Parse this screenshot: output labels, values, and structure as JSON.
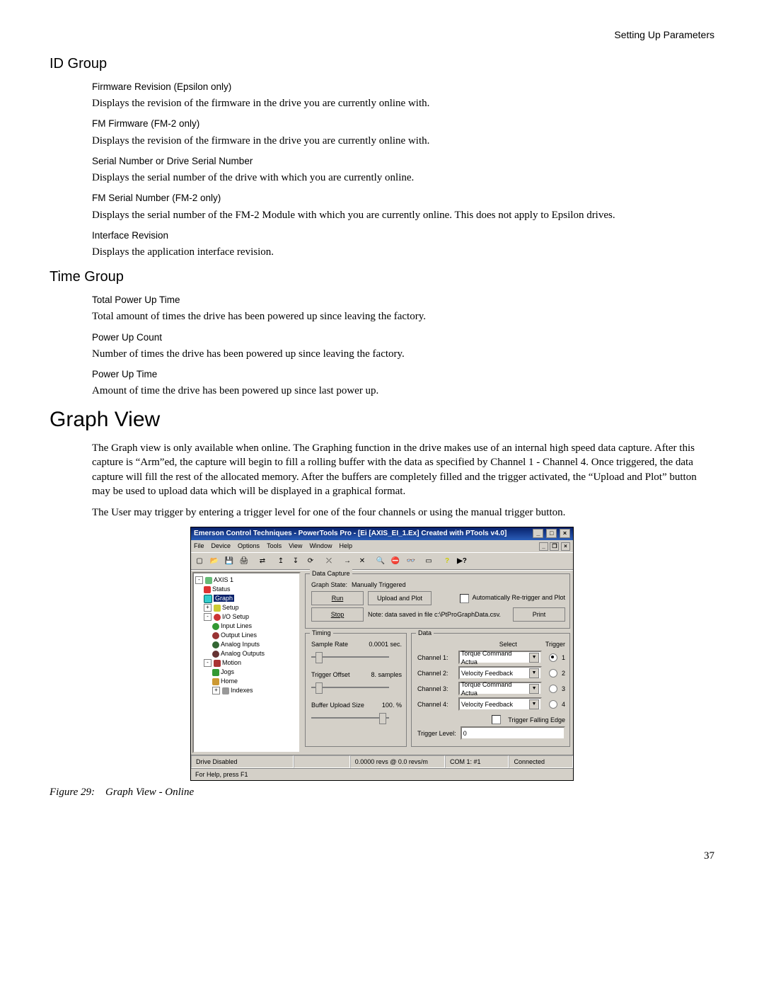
{
  "page": {
    "header_right": "Setting Up Parameters",
    "number": "37"
  },
  "sections": {
    "id_group": {
      "title": "ID Group",
      "items": [
        {
          "label": "Firmware Revision (Epsilon only)",
          "body": "Displays the revision of the firmware in the drive you are currently online with."
        },
        {
          "label": "FM Firmware (FM-2 only)",
          "body": "Displays the revision of the firmware in the drive you are currently online with."
        },
        {
          "label": "Serial Number or Drive Serial Number",
          "body": "Displays the serial number of the drive with which you are currently online."
        },
        {
          "label": "FM Serial Number (FM-2 only)",
          "body": "Displays the serial number of the FM-2 Module with which you are currently online. This does not apply to Epsilon drives."
        },
        {
          "label": "Interface Revision",
          "body": "Displays the application interface revision."
        }
      ]
    },
    "time_group": {
      "title": "Time Group",
      "items": [
        {
          "label": "Total Power Up Time",
          "body": "Total amount of times the drive has been powered up since leaving the factory."
        },
        {
          "label": "Power Up Count",
          "body": "Number of times the drive has been powered up since leaving the factory."
        },
        {
          "label": "Power Up Time",
          "body": "Amount of time the drive has been powered up since last power up."
        }
      ]
    },
    "graph_view": {
      "title": "Graph View",
      "para1": "The Graph view is only available when online. The Graphing function in the drive makes use of an internal high speed data capture. After this capture is “Arm”ed, the capture will begin to fill a rolling buffer with the data as specified by Channel 1 - Channel 4. Once triggered, the data capture will fill the rest of the allocated memory. After the buffers are completely filled and the trigger activated, the “Upload and Plot” button may be used to upload data which will be displayed in a graphical format.",
      "para2": "The User may trigger by entering a trigger level for one of the four channels or using the manual trigger button."
    }
  },
  "app": {
    "title": "Emerson Control Techniques - PowerTools Pro - [Ei   [AXIS_EI_1.Ex] Created with PTools v4.0]",
    "menu": [
      "File",
      "Device",
      "Options",
      "Tools",
      "View",
      "Window",
      "Help"
    ],
    "tree": {
      "root": "AXIS 1",
      "nodes": [
        "Status",
        "Graph",
        "Setup",
        "I/O Setup",
        "Input Lines",
        "Output Lines",
        "Analog Inputs",
        "Analog Outputs",
        "Motion",
        "Jogs",
        "Home",
        "Indexes"
      ]
    },
    "data_capture": {
      "title": "Data Capture",
      "graph_state_label": "Graph State:",
      "graph_state_value": "Manually Triggered",
      "run": "Run",
      "upload": "Upload and Plot",
      "stop": "Stop",
      "print": "Print",
      "auto": "Automatically Re-trigger and Plot",
      "note": "Note: data saved in file c:\\PtProGraphData.csv."
    },
    "timing": {
      "title": "Timing",
      "sample_rate_label": "Sample Rate",
      "sample_rate_value": "0.0001",
      "sample_rate_unit": "sec.",
      "trigger_offset_label": "Trigger Offset",
      "trigger_offset_value": "8.",
      "trigger_offset_unit": "samples",
      "buffer_label": "Buffer Upload Size",
      "buffer_value": "100.",
      "buffer_unit": "%"
    },
    "data": {
      "title": "Data",
      "select": "Select",
      "trigger": "Trigger",
      "ch1_label": "Channel 1:",
      "ch1_value": "Torque Command Actua",
      "ch1_num": "1",
      "ch2_label": "Channel 2:",
      "ch2_value": "Velocity Feedback",
      "ch2_num": "2",
      "ch3_label": "Channel 3:",
      "ch3_value": "Torque Command Actua",
      "ch3_num": "3",
      "ch4_label": "Channel 4:",
      "ch4_value": "Velocity Feedback",
      "ch4_num": "4",
      "falling": "Trigger Falling Edge",
      "trigger_level_label": "Trigger Level:",
      "trigger_level_value": "0"
    },
    "status": {
      "c1": "Drive Disabled",
      "c2": "0.0000 revs @ 0.0 revs/m",
      "c3": "COM 1: #1",
      "c4": "Connected",
      "help": "For Help, press F1"
    }
  },
  "figure": {
    "caption": "Figure 29: Graph View - Online"
  }
}
